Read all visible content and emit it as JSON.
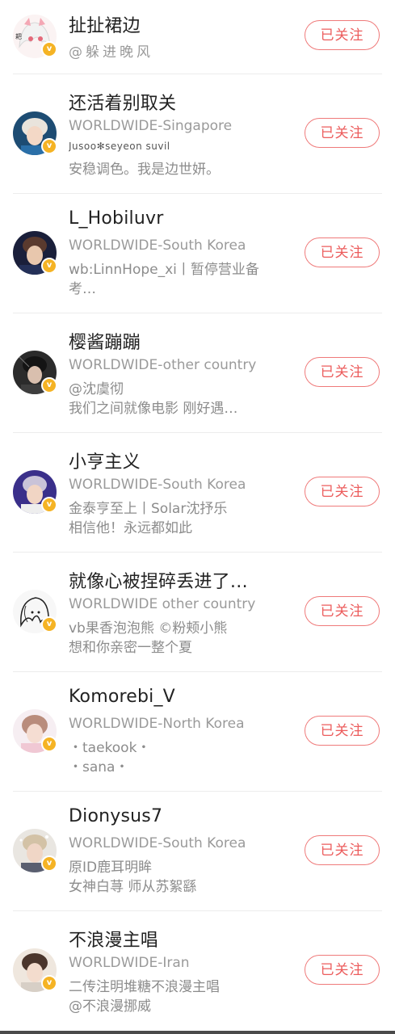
{
  "follow_label": "已关注",
  "rows": [
    {
      "name": "扯扯裙边",
      "sub": "@躲进晚风",
      "desc1": "",
      "desc2": ""
    },
    {
      "name": "还活着别取关",
      "sub": "WORLDWIDE-Singapore",
      "small": "Jusoo✻seyeon    suvil",
      "desc1": "安稳调色。我是边世妍。",
      "desc2": ""
    },
    {
      "name": "L_Hobiluvr",
      "sub": "WORLDWIDE-South Korea",
      "desc1": "wb:LinnHope_xi丨暂停营业备",
      "desc2": "考…"
    },
    {
      "name": "樱酱蹦蹦",
      "sub": "WORLDWIDE-other country",
      "desc1": "@沈虞彻",
      "desc2": "我们之间就像电影 刚好遇…"
    },
    {
      "name": "小亨主义",
      "sub": "WORLDWIDE-South Korea",
      "desc1": "金泰亨至上丨Solar沈抒乐",
      "desc2": "相信他！永远都如此"
    },
    {
      "name": "就像心被捏碎丢进了…",
      "sub": "WORLDWIDE other country",
      "desc1": "vb果香泡泡熊 ©粉颊小熊",
      "desc2": "想和你亲密一整个夏"
    },
    {
      "name": "Komorebi_V",
      "sub": "WORLDWIDE-North Korea",
      "desc1": "・taekook・",
      "desc2": "・sana・"
    },
    {
      "name": "Dionysus7",
      "sub": "WORLDWIDE-South Korea",
      "desc1": "原ID鹿耳明眸",
      "desc2": "女神白荨 师从苏絮繇"
    },
    {
      "name": "不浪漫主唱",
      "sub": "WORLDWIDE-Iran",
      "desc1": "二传注明堆糖不浪漫主唱",
      "desc2": "@不浪漫挪威"
    }
  ],
  "colors": {
    "accent": "#ec5c5c",
    "badge": "#f5b324"
  },
  "icons": {
    "verified": "v-badge-icon"
  }
}
